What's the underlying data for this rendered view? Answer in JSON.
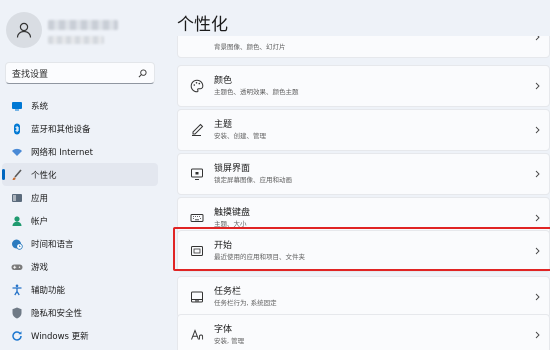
{
  "search": {
    "placeholder": "查找设置"
  },
  "nav": {
    "items": [
      {
        "label": "系统",
        "icon": "monitor-icon",
        "color": "#0078d4"
      },
      {
        "label": "蓝牙和其他设备",
        "icon": "bluetooth-icon",
        "color": "#0078d4"
      },
      {
        "label": "网络和 Internet",
        "icon": "wifi-icon",
        "color": "#4a8ad6"
      },
      {
        "label": "个性化",
        "icon": "brush-icon",
        "color": "#c66b2e",
        "active": true
      },
      {
        "label": "应用",
        "icon": "apps-icon",
        "color": "#5b6b7c"
      },
      {
        "label": "帐户",
        "icon": "account-icon",
        "color": "#1f9a6f"
      },
      {
        "label": "时间和语言",
        "icon": "globe-clock-icon",
        "color": "#2b7bbf"
      },
      {
        "label": "游戏",
        "icon": "gamepad-icon",
        "color": "#7a7a7a"
      },
      {
        "label": "辅助功能",
        "icon": "accessibility-icon",
        "color": "#2472c8"
      },
      {
        "label": "隐私和安全性",
        "icon": "shield-icon",
        "color": "#6f7a86"
      },
      {
        "label": "Windows 更新",
        "icon": "update-icon",
        "color": "#1d78d0"
      }
    ]
  },
  "main": {
    "title": "个性化",
    "cards": [
      {
        "title": "",
        "subtitle": "背景图像、颜色、幻灯片",
        "icon": "background-icon"
      },
      {
        "title": "颜色",
        "subtitle": "主题色、透明效果、颜色主题",
        "icon": "palette-icon"
      },
      {
        "title": "主题",
        "subtitle": "安装、创建、管理",
        "icon": "pen-icon"
      },
      {
        "title": "锁屏界面",
        "subtitle": "锁定屏幕图像、应用和动画",
        "icon": "lock-screen-icon"
      },
      {
        "title": "触摸键盘",
        "subtitle": "主题、大小",
        "icon": "keyboard-icon"
      },
      {
        "title": "开始",
        "subtitle": "最近使用的应用和项目、文件夹",
        "icon": "start-icon"
      },
      {
        "title": "任务栏",
        "subtitle": "任务栏行为, 系统固定",
        "icon": "taskbar-icon"
      },
      {
        "title": "字体",
        "subtitle": "安装, 管理",
        "icon": "font-icon"
      }
    ]
  },
  "colors": {
    "accent": "#0067c0",
    "highlight": "#e02424"
  }
}
